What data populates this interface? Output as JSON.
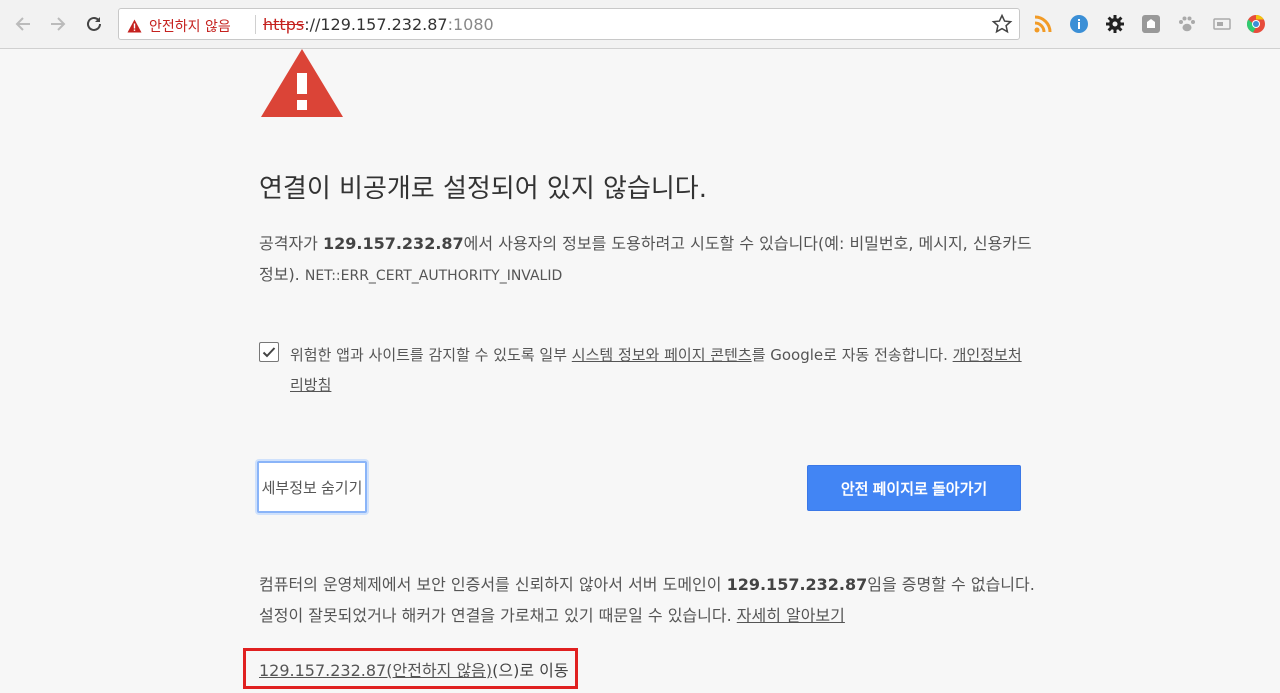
{
  "browser": {
    "security_label": "안전하지 않음",
    "url_scheme": "https",
    "url_sep": "://",
    "url_host": "129.157.232.87",
    "url_port": ":1080",
    "extensions": [
      "rss-icon",
      "info-icon",
      "gear-icon",
      "shield-icon",
      "paw-icon",
      "screen-icon",
      "chrome-menu-icon"
    ]
  },
  "content": {
    "headline": "연결이 비공개로 설정되어 있지 않습니다.",
    "description_pre": "공격자가 ",
    "host": "129.157.232.87",
    "description_post": "에서 사용자의 정보를 도용하려고 시도할 수 있습니다(예: 비밀번호, 메시지, 신용카드 정보). ",
    "error_code": "NET::ERR_CERT_AUTHORITY_INVALID",
    "checkbox_text_pre": "위험한 앱과 사이트를 감지할 수 있도록 일부 ",
    "checkbox_link_system": "시스템 정보와 페이지 콘텐츠",
    "checkbox_text_mid": "를 Google로 자동 전송합니다. ",
    "checkbox_link_privacy": "개인정보처리방침",
    "checkbox_checked": true,
    "details_button": "세부정보 숨기기",
    "back_button": "안전 페이지로 돌아가기",
    "details_pre": "컴퓨터의 운영체제에서 보안 인증서를 신뢰하지 않아서 서버 도메인이 ",
    "details_post": "임을 증명할 수 없습니다. 설정이 잘못되었거나 해커가 연결을 가로채고 있기 때문일 수 있습니다. ",
    "learn_more_link": "자세히 알아보기",
    "proceed_link": "129.157.232.87(안전하지 않음)",
    "proceed_suffix": "(으)로 이동"
  },
  "colors": {
    "warning_red": "#db4437",
    "button_blue": "#4285f4",
    "highlight_red": "#e02020"
  }
}
